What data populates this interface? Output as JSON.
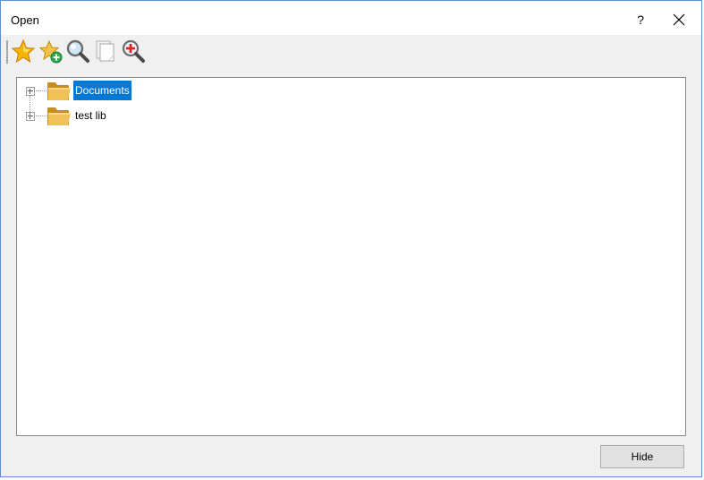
{
  "window": {
    "title": "Open",
    "help_label": "?",
    "close_icon": "close-icon"
  },
  "toolbar": {
    "buttons": [
      {
        "name": "favorites",
        "icon": "star-icon"
      },
      {
        "name": "add-favorite",
        "icon": "star-add-icon"
      },
      {
        "name": "search",
        "icon": "search-icon"
      },
      {
        "name": "copy",
        "icon": "copy-pages-icon"
      },
      {
        "name": "zoom-add",
        "icon": "zoom-add-icon"
      }
    ]
  },
  "tree": {
    "items": [
      {
        "label": "Documents",
        "selected": true,
        "icon": "folder-icon"
      },
      {
        "label": "test lib",
        "selected": false,
        "icon": "folder-icon"
      }
    ]
  },
  "footer": {
    "hide_label": "Hide"
  },
  "colors": {
    "selection": "#0078d7",
    "folder": "#e8b64b",
    "window_border": "#5b8fd6"
  }
}
